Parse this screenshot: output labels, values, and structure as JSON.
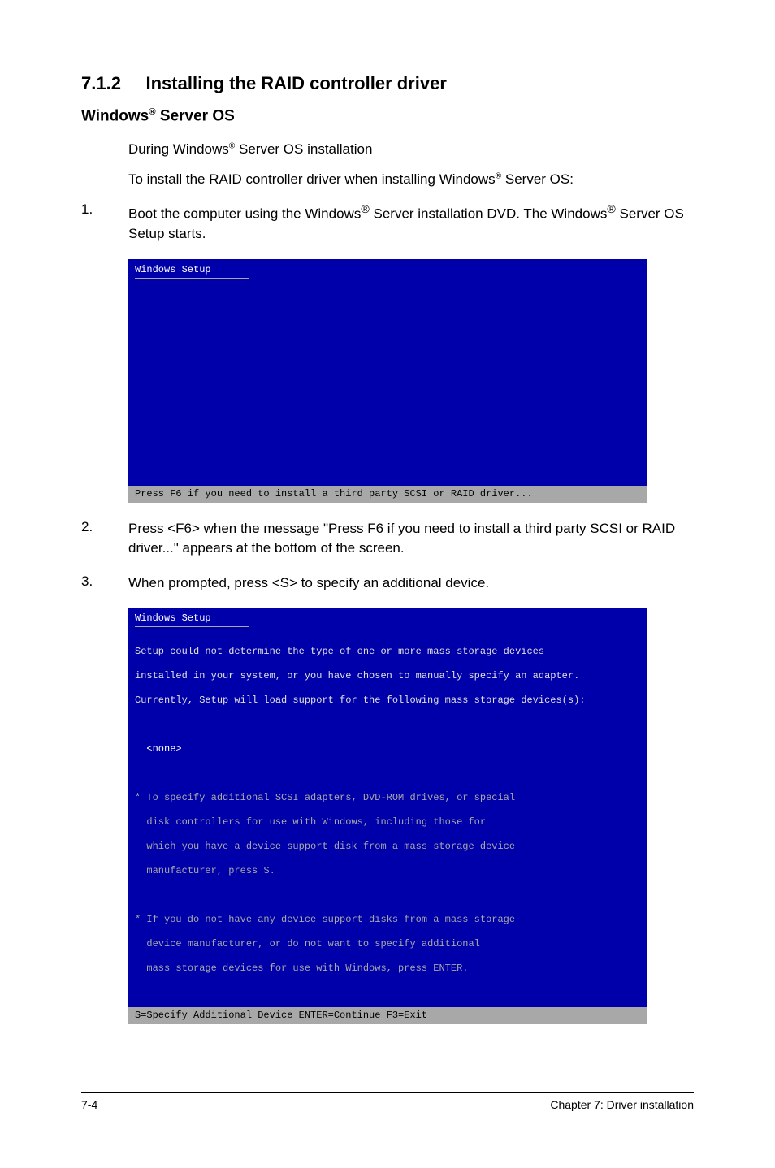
{
  "section": {
    "number": "7.1.2",
    "title": "Installing the RAID controller driver"
  },
  "subheading": {
    "prefix": "Windows",
    "suffix": " Server OS"
  },
  "intro": {
    "line1_prefix": "During Windows",
    "line1_suffix": " Server OS installation",
    "line2_prefix": "To install the RAID controller driver when installing Windows",
    "line2_suffix": " Server OS:"
  },
  "step1": {
    "num": "1.",
    "text_a": "Boot the computer using the Windows",
    "text_b": " Server installation DVD. The Windows",
    "text_c": " Server OS Setup starts."
  },
  "screen1": {
    "title": "Windows Setup",
    "status": "Press F6 if you need to install a third party SCSI or RAID driver..."
  },
  "step2": {
    "num": "2.",
    "text": "Press <F6> when the message \"Press F6 if you need to install a third party SCSI or RAID driver...\" appears at the bottom of the screen."
  },
  "step3": {
    "num": "3.",
    "text": "When prompted, press <S> to specify an additional device."
  },
  "screen2": {
    "title": "Windows Setup",
    "l1": "Setup could not determine the type of one or more mass storage devices",
    "l2": "installed in your system, or you have chosen to manually specify an adapter.",
    "l3": "Currently, Setup will load support for the following mass storage devices(s):",
    "none": "  <none>",
    "b1": "* To specify additional SCSI adapters, DVD-ROM drives, or special",
    "b2": "  disk controllers for use with Windows, including those for",
    "b3": "  which you have a device support disk from a mass storage device",
    "b4": "  manufacturer, press S.",
    "c1": "* If you do not have any device support disks from a mass storage",
    "c2": "  device manufacturer, or do not want to specify additional",
    "c3": "  mass storage devices for use with Windows, press ENTER.",
    "status": "S=Specify Additional Device    ENTER=Continue    F3=Exit"
  },
  "footer": {
    "page": "7-4",
    "chapter": "Chapter 7: Driver installation"
  }
}
